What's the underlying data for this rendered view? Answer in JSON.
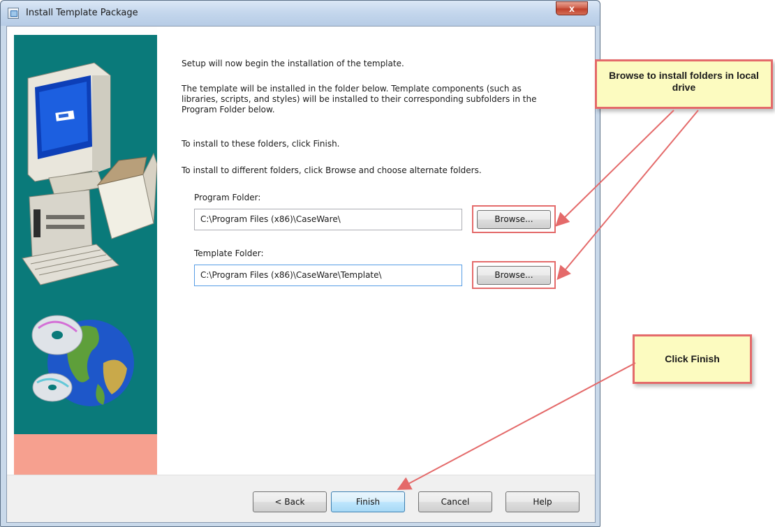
{
  "window": {
    "title": "Install Template Package",
    "close_glyph": "x"
  },
  "content": {
    "intro": "Setup will now begin the installation of the template.",
    "description": "The template will be installed in the folder below.  Template components (such as libraries, scripts, and styles) will be installed to their corresponding subfolders in the Program Folder below.",
    "finish_hint": "To install to these folders, click Finish.",
    "browse_hint": "To install to different folders, click Browse and choose alternate folders.",
    "program_folder": {
      "label": "Program Folder:",
      "value": "C:\\Program Files (x86)\\CaseWare\\",
      "browse_label": "Browse..."
    },
    "template_folder": {
      "label": "Template Folder:",
      "value": "C:\\Program Files (x86)\\CaseWare\\Template\\",
      "browse_label": "Browse..."
    }
  },
  "buttons": {
    "back": "< Back",
    "finish": "Finish",
    "cancel": "Cancel",
    "help": "Help"
  },
  "callouts": {
    "browse_note": "Browse to install folders in local drive",
    "finish_note": "Click Finish"
  },
  "colors": {
    "art_teal": "#0a7a7a",
    "art_pink": "#f6a08f",
    "highlight_red": "#e46a6a",
    "callout_yellow": "#fcfbc0"
  }
}
